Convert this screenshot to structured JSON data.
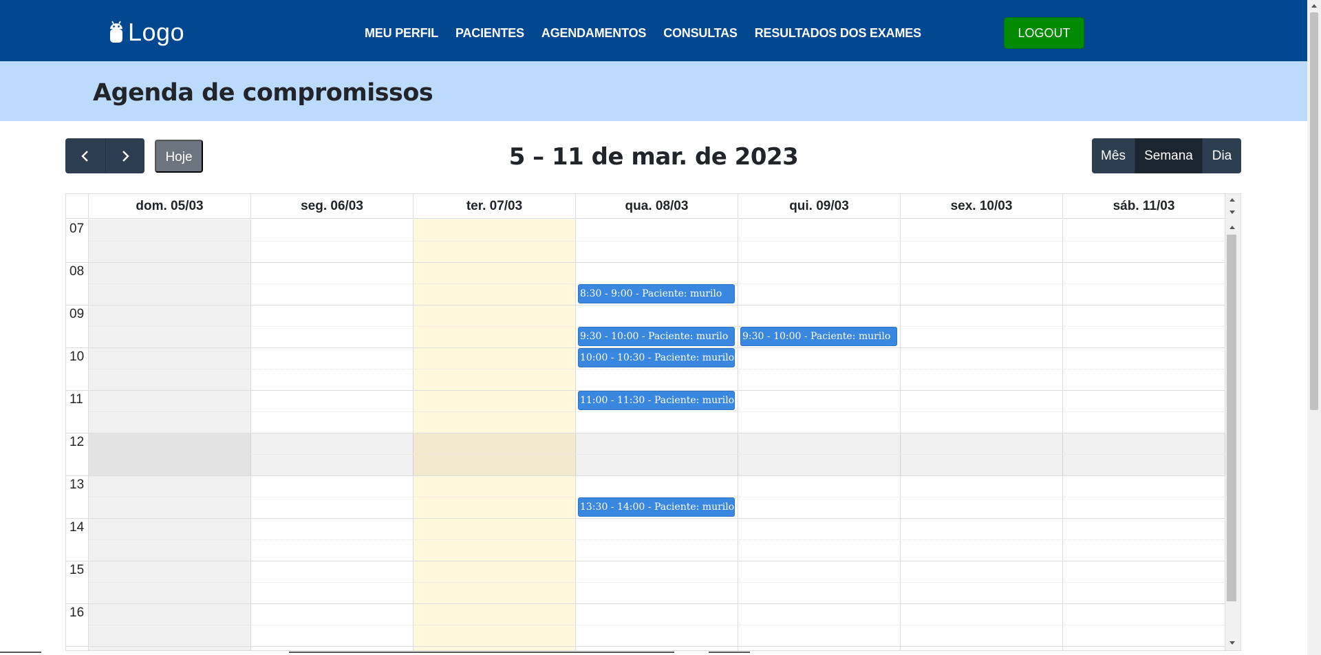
{
  "navbar": {
    "logo_text": "Logo",
    "logo_icon": "android-icon",
    "links": [
      "MEU PERFIL",
      "PACIENTES",
      "AGENDAMENTOS",
      "CONSULTAS",
      "RESULTADOS DOS EXAMES"
    ],
    "logout_label": "LOGOUT"
  },
  "header": {
    "title": "Agenda de compromissos"
  },
  "toolbar": {
    "prev_icon": "chevron-left-icon",
    "next_icon": "chevron-right-icon",
    "today_label": "Hoje",
    "title": "5 – 11 de mar. de 2023",
    "views": [
      "Mês",
      "Semana",
      "Dia"
    ],
    "active_view": "Semana"
  },
  "calendar": {
    "days": [
      "dom. 05/03",
      "seg. 06/03",
      "ter. 07/03",
      "qua. 08/03",
      "qui. 09/03",
      "sex. 10/03",
      "sáb. 11/03"
    ],
    "today_index": 2,
    "hours": [
      "07",
      "08",
      "09",
      "10",
      "11",
      "12",
      "13",
      "14",
      "15",
      "16"
    ],
    "events": [
      {
        "day": 3,
        "start": 8.5,
        "label": "8:30 - 9:00 - Paciente: murilo"
      },
      {
        "day": 3,
        "start": 9.5,
        "label": "9:30 - 10:00 - Paciente: murilo"
      },
      {
        "day": 4,
        "start": 9.5,
        "label": "9:30 - 10:00 - Paciente: murilo"
      },
      {
        "day": 3,
        "start": 10.0,
        "label": "10:00 - 10:30 - Paciente: murilo"
      },
      {
        "day": 3,
        "start": 11.0,
        "label": "11:00 - 11:30 - Paciente: murilo"
      },
      {
        "day": 3,
        "start": 13.5,
        "label": "13:30 - 14:00 - Paciente: murilo"
      }
    ],
    "colors": {
      "event": "#3a87e0",
      "today": "#fff8dc",
      "sunday": "#f1f1f1"
    }
  }
}
